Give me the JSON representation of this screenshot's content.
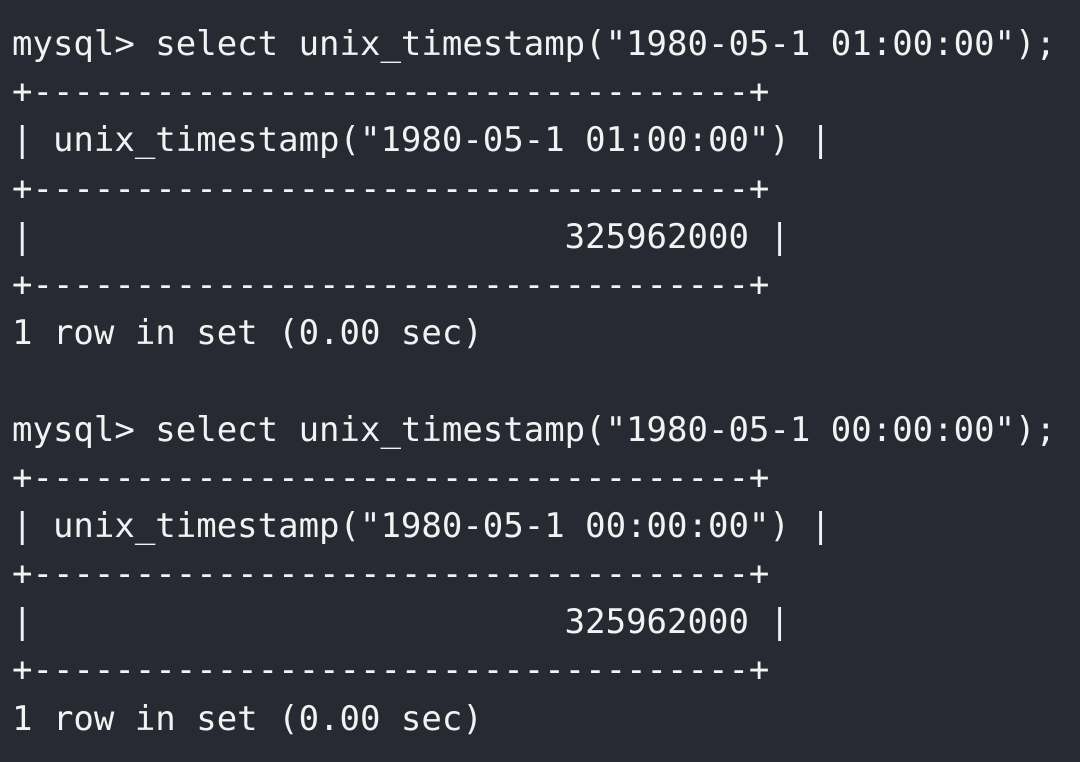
{
  "blocks": [
    {
      "command": "mysql> select unix_timestamp(\"1980-05-1 01:00:00\");",
      "border_top": "+-----------------------------------+",
      "header_row": "| unix_timestamp(\"1980-05-1 01:00:00\") |",
      "border_mid": "+-----------------------------------+",
      "value_row": "|                          325962000 |",
      "border_bottom": "+-----------------------------------+",
      "status": "1 row in set (0.00 sec)"
    },
    {
      "command": "mysql> select unix_timestamp(\"1980-05-1 00:00:00\");",
      "border_top": "+-----------------------------------+",
      "header_row": "| unix_timestamp(\"1980-05-1 00:00:00\") |",
      "border_mid": "+-----------------------------------+",
      "value_row": "|                          325962000 |",
      "border_bottom": "+-----------------------------------+",
      "status": "1 row in set (0.00 sec)"
    }
  ]
}
